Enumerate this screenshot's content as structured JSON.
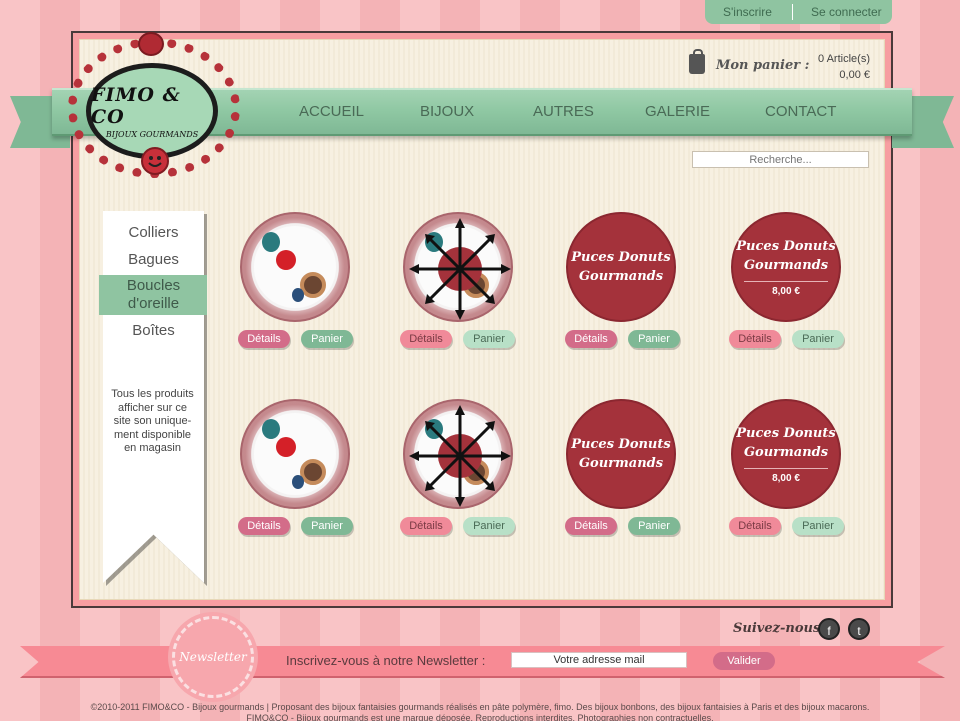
{
  "account": {
    "signup": "S'inscrire",
    "login": "Se connecter"
  },
  "logo": {
    "title": "FIMO & CO",
    "subtitle": "BIJOUX GOURMANDS"
  },
  "cart": {
    "label": "Mon panier :",
    "count": "0 Article(s)",
    "total": "0,00 €"
  },
  "nav": [
    "ACCUEIL",
    "BIJOUX",
    "AUTRES",
    "GALERIE",
    "CONTACT"
  ],
  "search": {
    "placeholder": "Recherche..."
  },
  "sidebar": {
    "items": [
      "Colliers",
      "Bagues",
      "Boucles d'oreille",
      "Boîtes"
    ],
    "active": "Boucles d'oreille",
    "note": "Tous les produits afficher sur ce site son unique-ment disponible en magasin"
  },
  "products": {
    "tile_text": "Puces Donuts Gourmands",
    "price": "8,00 €",
    "details_label": "Détails",
    "cart_label": "Panier"
  },
  "follow": {
    "label": "Suivez-nous",
    "facebook": "f",
    "twitter": "t"
  },
  "newsletter": {
    "badge": "Newsletter",
    "label": "Inscrivez-vous à notre Newsletter :",
    "input_value": "Votre adresse mail",
    "submit": "Valider"
  },
  "footer": {
    "line1": "©2010-2011 FIMO&CO - Bijoux gourmands | Proposant des bijoux fantaisies gourmands réalisés en pâte polymère, fimo. Des bijoux bonbons, des bijoux fantaisies à Paris et des bijoux macarons.",
    "line2": "FIMO&CO - Bijoux gourmands est une marque déposée. Reproductions interdites. Photographies non contractuelles."
  },
  "colors": {
    "mint": "#8fc4a1",
    "pink": "#f79ea1",
    "burgundy": "#a4323b",
    "rose_button": "#d36c89"
  }
}
